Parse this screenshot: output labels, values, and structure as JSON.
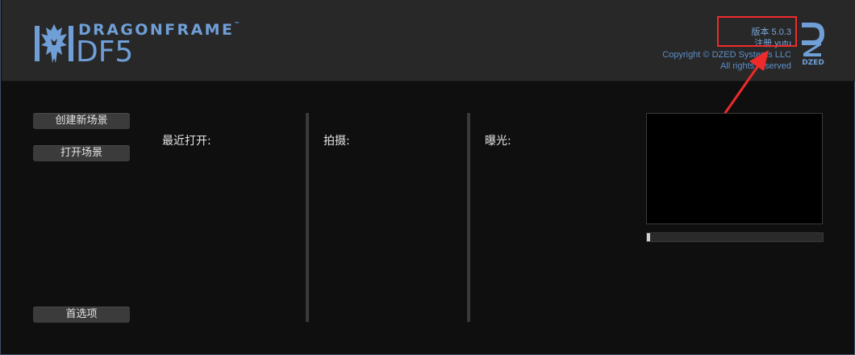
{
  "brand": {
    "name": "DRAGONFRAME",
    "trademark": "™",
    "product": "DF5"
  },
  "about": {
    "version_text": "版本 5.0.3",
    "registration_text": "注册 yutu",
    "copyright_text": "Copyright © DZED Systems LLC",
    "rights_text": "All rights reserved",
    "company_logo": "DZED"
  },
  "actions": {
    "new_scene": "创建新场景",
    "open_scene": "打开场景",
    "preferences": "首选项"
  },
  "columns": {
    "recent": "最近打开:",
    "shoot": "拍摄:",
    "exposure": "曝光:"
  },
  "preview": {
    "progress": 0.02
  },
  "annotation": {
    "color": "#ee2a2a"
  },
  "theme": {
    "accent": "#6f9fd6"
  }
}
